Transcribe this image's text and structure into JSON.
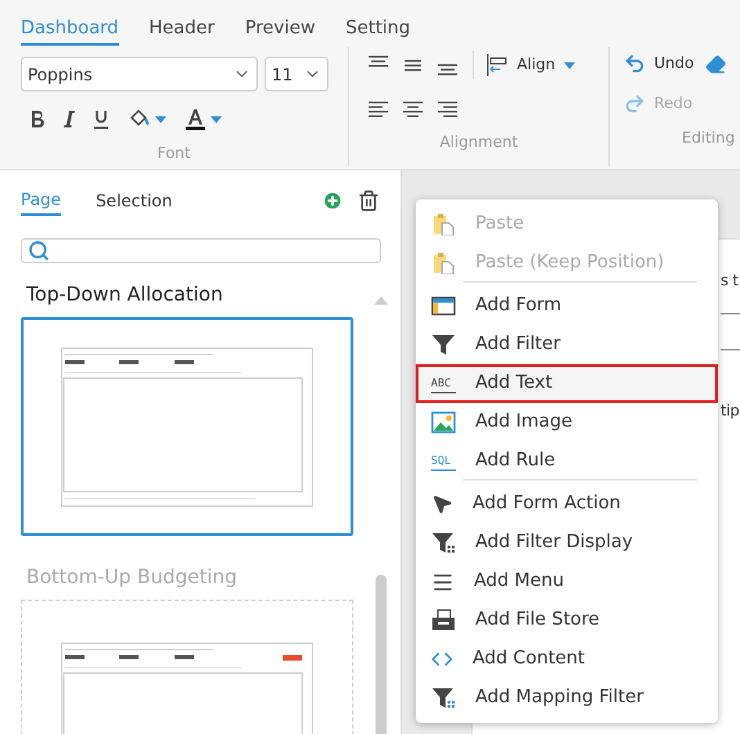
{
  "ribbon": {
    "tabs": [
      {
        "label": "Dashboard",
        "selected": true
      },
      {
        "label": "Header",
        "selected": false
      },
      {
        "label": "Preview",
        "selected": false
      },
      {
        "label": "Setting",
        "selected": false
      }
    ],
    "font": {
      "family": "Poppins",
      "size": "11",
      "label": "Font"
    },
    "alignment": {
      "align_button": "Align",
      "label": "Alignment"
    },
    "editing": {
      "undo": {
        "label": "Undo",
        "disabled": false
      },
      "redo": {
        "label": "Redo",
        "disabled": true
      },
      "label": "Editing"
    }
  },
  "sidebar": {
    "tabs": [
      {
        "label": "Page",
        "selected": true
      },
      {
        "label": "Selection",
        "selected": false
      }
    ],
    "pages": [
      {
        "title": "Top-Down Allocation",
        "selected": true,
        "kind": "plain"
      },
      {
        "title": "Bottom-Up Budgeting",
        "selected": false,
        "kind": "button"
      }
    ]
  },
  "canvas": {
    "texts": [
      "s t",
      "tip"
    ]
  },
  "context_menu": {
    "items": [
      {
        "label": "Paste",
        "kind": "paste",
        "disabled": true,
        "selected": false,
        "separator_after": false
      },
      {
        "label": "Paste (Keep Position)",
        "kind": "paste",
        "disabled": true,
        "selected": false,
        "separator_after": true
      },
      {
        "label": "Add Form",
        "kind": "form",
        "disabled": false,
        "selected": false,
        "separator_after": false
      },
      {
        "label": "Add Filter",
        "kind": "filter",
        "disabled": false,
        "selected": false,
        "separator_after": false
      },
      {
        "label": "Add Text",
        "kind": "text",
        "icon_text": "ABC",
        "disabled": false,
        "selected": true,
        "separator_after": false
      },
      {
        "label": "Add Image",
        "kind": "image",
        "disabled": false,
        "selected": false,
        "separator_after": false
      },
      {
        "label": "Add Rule",
        "kind": "rule",
        "icon_text": "SQL",
        "disabled": false,
        "selected": false,
        "separator_after": true
      },
      {
        "label": "Add Form Action",
        "kind": "action",
        "disabled": false,
        "selected": false,
        "separator_after": false
      },
      {
        "label": "Add Filter Display",
        "kind": "filter_display",
        "disabled": false,
        "selected": false,
        "separator_after": false
      },
      {
        "label": "Add Menu",
        "kind": "menu",
        "disabled": false,
        "selected": false,
        "separator_after": false
      },
      {
        "label": "Add File Store",
        "kind": "file_store",
        "disabled": false,
        "selected": false,
        "separator_after": false
      },
      {
        "label": "Add Content",
        "kind": "content",
        "disabled": false,
        "selected": false,
        "separator_after": false
      },
      {
        "label": "Add Mapping Filter",
        "kind": "mapping_filter",
        "disabled": false,
        "selected": false,
        "separator_after": false
      }
    ]
  }
}
